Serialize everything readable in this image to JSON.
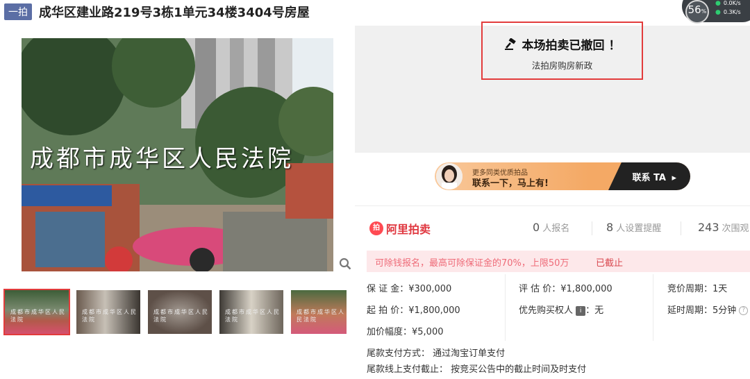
{
  "title": {
    "badge": "一拍",
    "text": "成华区建业路219号3栋1单元34楼3404号房屋"
  },
  "network": {
    "percent": "56",
    "percent_unit": "%",
    "rate_up": "0.0K/s",
    "rate_down": "0.3K/s"
  },
  "gallery": {
    "main_watermark": "成都市成华区人民法院",
    "thumb_labels": [
      "成都市成华区人民法院",
      "成都市成华区人民法院",
      "成都市成华区人民法院",
      "成都市成华区人民法院",
      "成都市成华区人民法院"
    ],
    "zoom_icon": "magnifier-icon"
  },
  "notice": {
    "heading": "本场拍卖已撤回 ！",
    "link": "法拍房购房新政",
    "icon": "gavel-icon"
  },
  "ad": {
    "line1": "更多同类优质拍品",
    "line2": "联系一下，马上有!",
    "cta": "联系 TA",
    "arrow": "▸"
  },
  "brand": {
    "logo_text": "拍",
    "name": "阿里拍卖"
  },
  "stats": [
    {
      "value": "0",
      "label": "人报名"
    },
    {
      "value": "8",
      "label": "人设置提醒"
    },
    {
      "value": "243",
      "label": "次围观"
    }
  ],
  "deposit_bar": {
    "text": "可除钱报名，最高可除保证金的70%，上限50万",
    "status": "已截止"
  },
  "details": {
    "deposit": "保 证 金：¥300,000",
    "start_price": "起 拍 价：¥1,800,000",
    "increment": "加价幅度：¥5,000",
    "appraisal": "评 估 价：¥1,800,000",
    "priority_label": "优先购买权人",
    "priority_badge": "i",
    "priority_value": "：无",
    "cycle": "竞价周期：1天",
    "delay": "延时周期：5分钟",
    "payment_method": "尾款支付方式：  通过淘宝订单支付",
    "payment_deadline": "尾款线上支付截止：  按竞买公告中的截止时间及时支付"
  }
}
